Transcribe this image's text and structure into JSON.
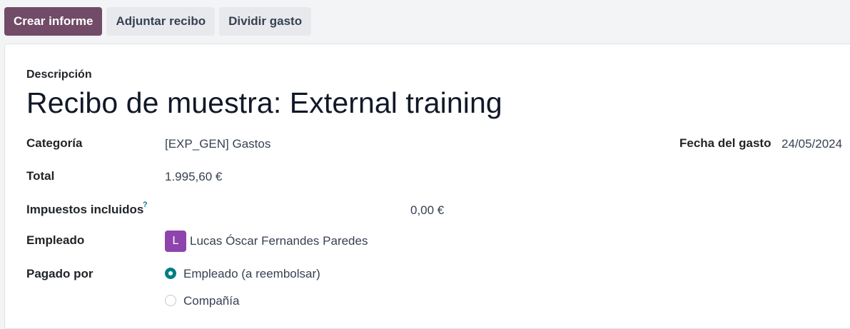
{
  "toolbar": {
    "create_report": "Crear informe",
    "attach_receipt": "Adjuntar recibo",
    "split_expense": "Dividir gasto"
  },
  "form": {
    "description_label": "Descripción",
    "title": "Recibo de muestra: External training",
    "category_label": "Categoría",
    "category_value": "[EXP_GEN] Gastos",
    "date_label": "Fecha del gasto",
    "date_value": "24/05/2024",
    "total_label": "Total",
    "total_value": "1.995,60 €",
    "taxes_label": "Impuestos incluidos",
    "taxes_tooltip": "?",
    "taxes_value": "0,00 €",
    "employee_label": "Empleado",
    "employee_avatar": "L",
    "employee_value": "Lucas Óscar Fernandes Paredes",
    "paid_by_label": "Pagado por",
    "paid_by_options": [
      {
        "label": "Empleado (a reembolsar)",
        "selected": true
      },
      {
        "label": "Compañía",
        "selected": false
      }
    ]
  },
  "colors": {
    "primary": "#714b67",
    "accent": "#017e84",
    "avatar": "#8e44ad"
  }
}
